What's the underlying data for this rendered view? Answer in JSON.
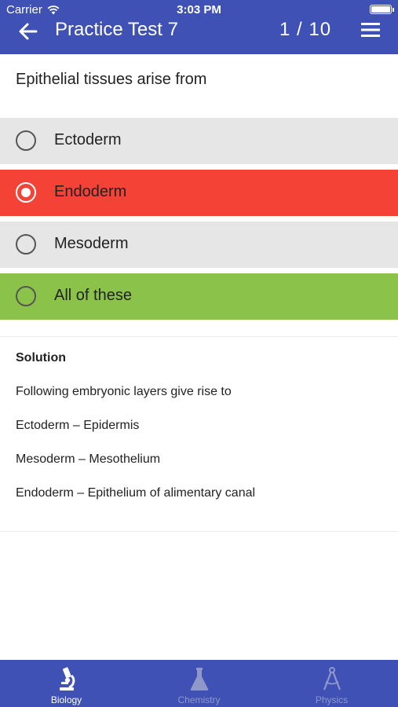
{
  "status_bar": {
    "carrier": "Carrier",
    "time": "3:03 PM"
  },
  "header": {
    "title": "Practice Test 7",
    "counter": "1 / 10"
  },
  "question": {
    "text": "Epithelial tissues arise from"
  },
  "options": [
    {
      "label": "Ectoderm",
      "state": "neutral"
    },
    {
      "label": "Endoderm",
      "state": "selected-wrong"
    },
    {
      "label": "Mesoderm",
      "state": "neutral"
    },
    {
      "label": "All of these",
      "state": "correct"
    }
  ],
  "solution": {
    "heading": "Solution",
    "lines": [
      "Following embryonic layers give rise to",
      "Ectoderm – Epidermis",
      "Mesoderm – Mesothelium",
      "Endoderm – Epithelium of alimentary canal"
    ]
  },
  "tabs": [
    {
      "label": "Biology",
      "icon": "microscope-icon",
      "active": true
    },
    {
      "label": "Chemistry",
      "icon": "flask-icon",
      "active": false
    },
    {
      "label": "Physics",
      "icon": "compass-icon",
      "active": false
    }
  ],
  "colors": {
    "primary": "#3f51b5",
    "wrong": "#f44336",
    "correct": "#8bc34a",
    "neutral": "#e6e6e6"
  }
}
